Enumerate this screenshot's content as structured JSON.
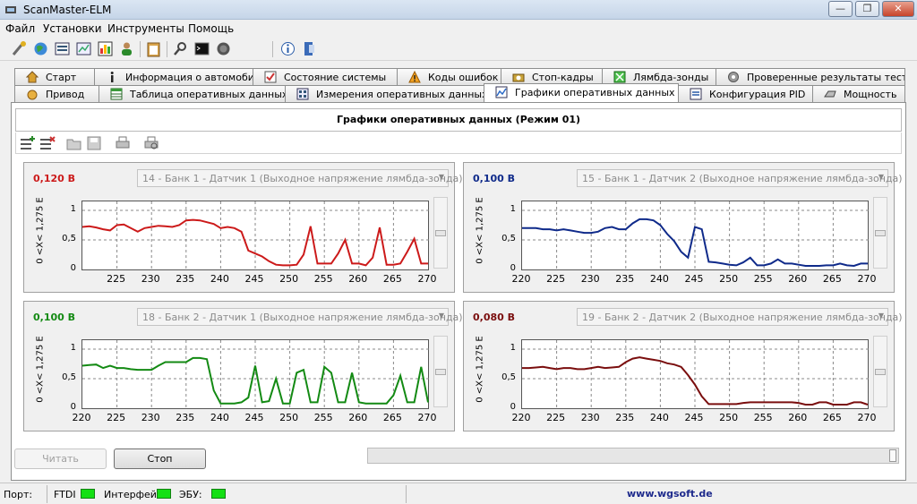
{
  "window": {
    "title": "ScanMaster-ELM",
    "min_label": "—",
    "max_label": "❐",
    "close_label": "✕"
  },
  "menu": [
    "Файл",
    "Установки",
    "Инструменты",
    "Помощь"
  ],
  "toolbar_icons": [
    "connect-icon",
    "globe-icon",
    "vehicle-info-icon",
    "monitor-icon",
    "chart-icon",
    "user-icon",
    "clipboard-icon",
    "search-icon",
    "terminal-icon",
    "disconnect-icon",
    "info-icon",
    "exit-icon"
  ],
  "tabs": {
    "row1": [
      {
        "label": "Старт",
        "icon": "home-icon"
      },
      {
        "label": "Информация о автомобиле",
        "icon": "info-icon"
      },
      {
        "label": "Состояние системы",
        "icon": "check-icon"
      },
      {
        "label": "Коды ошибок",
        "icon": "warning-icon"
      },
      {
        "label": "Стоп-кадры",
        "icon": "camera-icon"
      },
      {
        "label": "Лямбда-зонды",
        "icon": "sensor-icon"
      },
      {
        "label": "Проверенные результаты теста",
        "icon": "gear-icon"
      }
    ],
    "row2": [
      {
        "label": "Привод",
        "icon": "drive-icon"
      },
      {
        "label": "Таблица оперативных данных",
        "icon": "table-icon"
      },
      {
        "label": "Измерения оперативных данных",
        "icon": "gauge-icon"
      },
      {
        "label": "Графики оперативных данных",
        "icon": "graph-icon",
        "active": true
      },
      {
        "label": "Конфигурация PID",
        "icon": "config-icon"
      },
      {
        "label": "Мощность",
        "icon": "power-icon"
      }
    ]
  },
  "header_title": "Графики оперативных данных (Режим 01)",
  "chart_toolbar_icons": [
    "add-graph-icon",
    "remove-graph-icon",
    "open-icon",
    "save-icon",
    "print-icon",
    "print-preview-icon"
  ],
  "chart_data": [
    {
      "type": "line",
      "value_label": "0,120 В",
      "selector": "14 - Банк 1 - Датчик 1 (Выходное напряжение лямбда-зонда)",
      "color": "#cc1a1a",
      "ylabel": "0 <X< 1,275 E",
      "xlim": [
        220,
        270
      ],
      "ylim": [
        0,
        1
      ],
      "y_ticks": [
        "0",
        "0,5",
        "1"
      ],
      "x_ticks": [
        "225",
        "230",
        "235",
        "240",
        "245",
        "250",
        "255",
        "260",
        "265",
        "270"
      ],
      "x": [
        220,
        221,
        222,
        223,
        224,
        225,
        226,
        227,
        228,
        229,
        230,
        231,
        232,
        233,
        234,
        235,
        236,
        237,
        238,
        239,
        240,
        241,
        242,
        243,
        244,
        245,
        246,
        247,
        248,
        249,
        250,
        251,
        252,
        253,
        254,
        255,
        256,
        257,
        258,
        259,
        260,
        261,
        262,
        263,
        264,
        265,
        266,
        267,
        268,
        269,
        270
      ],
      "y": [
        0.72,
        0.73,
        0.71,
        0.68,
        0.66,
        0.75,
        0.76,
        0.7,
        0.64,
        0.7,
        0.72,
        0.74,
        0.73,
        0.72,
        0.75,
        0.83,
        0.84,
        0.83,
        0.8,
        0.77,
        0.7,
        0.72,
        0.7,
        0.64,
        0.32,
        0.27,
        0.22,
        0.14,
        0.08,
        0.07,
        0.07,
        0.08,
        0.25,
        0.73,
        0.1,
        0.1,
        0.1,
        0.27,
        0.5,
        0.1,
        0.1,
        0.07,
        0.2,
        0.71,
        0.08,
        0.08,
        0.1,
        0.3,
        0.52,
        0.1,
        0.1
      ]
    },
    {
      "type": "line",
      "value_label": "0,100 В",
      "selector": "15 - Банк 1 - Датчик 2 (Выходное напряжение лямбда-зонда)",
      "color": "#0f2a8a",
      "ylabel": "0 <X< 1,275 E",
      "xlim": [
        220,
        270
      ],
      "ylim": [
        0,
        1
      ],
      "y_ticks": [
        "0",
        "0,5",
        "1"
      ],
      "x_ticks": [
        "220",
        "225",
        "230",
        "235",
        "240",
        "245",
        "250",
        "255",
        "260",
        "265",
        "270"
      ],
      "x": [
        220,
        221,
        222,
        223,
        224,
        225,
        226,
        227,
        228,
        229,
        230,
        231,
        232,
        233,
        234,
        235,
        236,
        237,
        238,
        239,
        240,
        241,
        242,
        243,
        244,
        245,
        246,
        247,
        248,
        249,
        250,
        251,
        252,
        253,
        254,
        255,
        256,
        257,
        258,
        259,
        260,
        261,
        262,
        263,
        264,
        265,
        266,
        267,
        268,
        269,
        270
      ],
      "y": [
        0.7,
        0.7,
        0.7,
        0.68,
        0.68,
        0.66,
        0.68,
        0.66,
        0.64,
        0.62,
        0.62,
        0.64,
        0.7,
        0.72,
        0.68,
        0.68,
        0.78,
        0.85,
        0.85,
        0.83,
        0.75,
        0.6,
        0.48,
        0.3,
        0.2,
        0.72,
        0.68,
        0.13,
        0.12,
        0.1,
        0.08,
        0.07,
        0.12,
        0.2,
        0.07,
        0.07,
        0.1,
        0.17,
        0.1,
        0.1,
        0.08,
        0.06,
        0.06,
        0.06,
        0.07,
        0.07,
        0.1,
        0.07,
        0.06,
        0.1,
        0.1
      ]
    },
    {
      "type": "line",
      "value_label": "0,100 В",
      "selector": "18 - Банк 2 - Датчик 1 (Выходное напряжение лямбда-зонда)",
      "color": "#138a13",
      "ylabel": "0 <X< 1,275 E",
      "xlim": [
        220,
        270
      ],
      "ylim": [
        0,
        1
      ],
      "y_ticks": [
        "0",
        "0,5",
        "1"
      ],
      "x_ticks": [
        "220",
        "225",
        "230",
        "235",
        "240",
        "245",
        "250",
        "255",
        "260",
        "265",
        "270"
      ],
      "x": [
        220,
        221,
        222,
        223,
        224,
        225,
        226,
        227,
        228,
        229,
        230,
        231,
        232,
        233,
        234,
        235,
        236,
        237,
        238,
        239,
        240,
        241,
        242,
        243,
        244,
        245,
        246,
        247,
        248,
        249,
        250,
        251,
        252,
        253,
        254,
        255,
        256,
        257,
        258,
        259,
        260,
        261,
        262,
        263,
        264,
        265,
        266,
        267,
        268,
        269,
        270
      ],
      "y": [
        0.72,
        0.73,
        0.74,
        0.68,
        0.72,
        0.68,
        0.68,
        0.66,
        0.65,
        0.65,
        0.65,
        0.72,
        0.78,
        0.78,
        0.78,
        0.78,
        0.85,
        0.85,
        0.83,
        0.3,
        0.08,
        0.08,
        0.08,
        0.1,
        0.18,
        0.72,
        0.1,
        0.12,
        0.5,
        0.08,
        0.08,
        0.6,
        0.65,
        0.1,
        0.1,
        0.7,
        0.6,
        0.1,
        0.1,
        0.6,
        0.1,
        0.08,
        0.08,
        0.08,
        0.08,
        0.22,
        0.55,
        0.1,
        0.1,
        0.7,
        0.1
      ]
    },
    {
      "type": "line",
      "value_label": "0,080 В",
      "selector": "19 - Банк 2 - Датчик 2 (Выходное напряжение лямбда-зонда)",
      "color": "#7a0e0e",
      "ylabel": "0 <X< 1,275 E",
      "xlim": [
        220,
        270
      ],
      "ylim": [
        0,
        1
      ],
      "y_ticks": [
        "0",
        "0,5",
        "1"
      ],
      "x_ticks": [
        "220",
        "225",
        "230",
        "235",
        "240",
        "245",
        "250",
        "255",
        "260",
        "265",
        "270"
      ],
      "x": [
        220,
        221,
        222,
        223,
        224,
        225,
        226,
        227,
        228,
        229,
        230,
        231,
        232,
        233,
        234,
        235,
        236,
        237,
        238,
        239,
        240,
        241,
        242,
        243,
        244,
        245,
        246,
        247,
        248,
        249,
        250,
        251,
        252,
        253,
        254,
        255,
        256,
        257,
        258,
        259,
        260,
        261,
        262,
        263,
        264,
        265,
        266,
        267,
        268,
        269,
        270
      ],
      "y": [
        0.68,
        0.68,
        0.69,
        0.7,
        0.68,
        0.66,
        0.68,
        0.68,
        0.66,
        0.66,
        0.68,
        0.7,
        0.68,
        0.69,
        0.7,
        0.78,
        0.84,
        0.86,
        0.84,
        0.82,
        0.8,
        0.76,
        0.74,
        0.7,
        0.56,
        0.4,
        0.2,
        0.07,
        0.07,
        0.07,
        0.07,
        0.07,
        0.09,
        0.1,
        0.1,
        0.1,
        0.1,
        0.1,
        0.1,
        0.1,
        0.09,
        0.06,
        0.06,
        0.1,
        0.1,
        0.06,
        0.06,
        0.06,
        0.1,
        0.1,
        0.06
      ]
    }
  ],
  "buttons": {
    "read": "Читать",
    "stop": "Стоп"
  },
  "status": {
    "port_label": "Порт:",
    "port_value": "FTDI",
    "interface_label": "Интерфейс:",
    "ecu_label": "ЭБУ:",
    "led_color": "#14e014",
    "website": "www.wgsoft.de"
  }
}
